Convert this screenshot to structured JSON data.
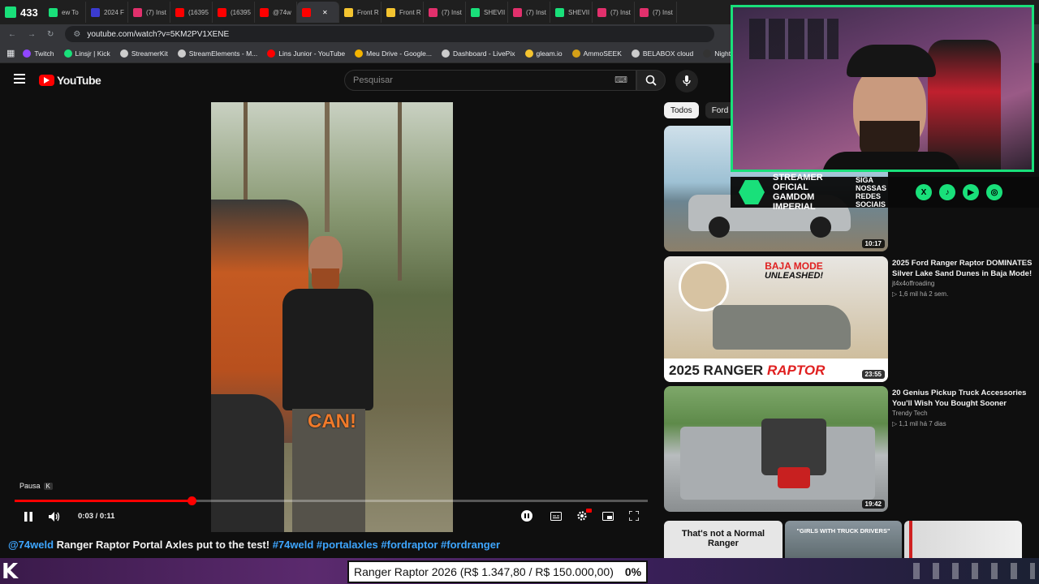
{
  "browser": {
    "counter": "433",
    "tabs": [
      {
        "label": "ew To",
        "color": "#19e07a"
      },
      {
        "label": "2024 F",
        "color": "#3b3bd1"
      },
      {
        "label": "(7) Inst",
        "color": "#e1306c"
      },
      {
        "label": "(16395",
        "color": "#ff0000"
      },
      {
        "label": "(16395",
        "color": "#ff0000"
      },
      {
        "label": "@74w",
        "color": "#ff0000"
      },
      {
        "label": "",
        "color": "#ff0000",
        "active": true
      },
      {
        "label": "Front R",
        "color": "#f4c430"
      },
      {
        "label": "Front R",
        "color": "#f4c430"
      },
      {
        "label": "(7) Inst",
        "color": "#e1306c"
      },
      {
        "label": "SHEVII",
        "color": "#19e07a"
      },
      {
        "label": "(7) Inst",
        "color": "#e1306c"
      },
      {
        "label": "SHEVII",
        "color": "#19e07a"
      },
      {
        "label": "(7) Inst",
        "color": "#e1306c"
      },
      {
        "label": "(7) Inst",
        "color": "#e1306c"
      }
    ],
    "url": "youtube.com/watch?v=5KM2PV1XENE",
    "bookmarks": [
      {
        "label": "Twitch",
        "color": "#9146ff"
      },
      {
        "label": "Linsjr | Kick",
        "color": "#19e07a"
      },
      {
        "label": "StreamerKit",
        "color": "#cccccc"
      },
      {
        "label": "StreamElements - M...",
        "color": "#cccccc"
      },
      {
        "label": "Lins Junior - YouTube",
        "color": "#ff0000"
      },
      {
        "label": "Meu Drive - Google...",
        "color": "#f4b400"
      },
      {
        "label": "Dashboard - LivePix",
        "color": "#cccccc"
      },
      {
        "label": "gleam.io",
        "color": "#f4c430"
      },
      {
        "label": "AmmoSEEK",
        "color": "#d4a017"
      },
      {
        "label": "BELABOX cloud",
        "color": "#cccccc"
      },
      {
        "label": "Nightbot - Comm",
        "color": "#333333"
      }
    ]
  },
  "youtube": {
    "logo_text": "YouTube",
    "search_placeholder": "Pesquisar",
    "keyboard_badge": "⌨",
    "player": {
      "caption": "CAN!",
      "tooltip_label": "Pausa",
      "tooltip_key": "K",
      "time": "0:03 / 0:11",
      "progress": 0.28
    },
    "video_title_prefix": "@74weld",
    "video_title_main": " Ranger Raptor Portal Axles put to the test! ",
    "video_title_tags": "#74weld #portalaxles #fordraptor #fordranger",
    "chips": [
      "Todos",
      "Ford R"
    ],
    "recommendations": [
      {
        "duration": "10:17",
        "title": "",
        "channel": "",
        "meta": ""
      },
      {
        "duration": "23:55",
        "title": "2025 Ford Ranger Raptor DOMINATES Silver Lake Sand Dunes in Baja Mode!",
        "channel": "jt4x4offroading",
        "meta": "▷ 1,6 mil  há 2 sem.",
        "thumb_text_top": "BAJA MODE",
        "thumb_text_top2": "UNLEASHED!",
        "thumb_text_bottom1": "2025 RANGER ",
        "thumb_text_bottom2": "RAPTOR"
      },
      {
        "duration": "19:42",
        "title": "20 Genius Pickup Truck Accessories You'll Wish You Bought Sooner",
        "channel": "Trendy Tech",
        "meta": "▷ 1,1 mil  há 7 dias"
      }
    ],
    "shorts": [
      {
        "text": "That's not a Normal Ranger"
      },
      {
        "text": "\"GIRLS WITH TRUCK DRIVERS\""
      },
      {
        "text": ""
      }
    ]
  },
  "overlay": {
    "banner_main": "STREAMER OFICIAL GAMDOM IMPERIAL",
    "banner_sub": "SIGA NOSSAS REDES SOCIAIS",
    "goal_text": "Ranger Raptor 2026 (R$ 1.347,80 / R$ 150.000,00)",
    "goal_percent": "0%"
  },
  "colors": {
    "accent": "#ff0000",
    "link": "#3ea6ff",
    "brand_green": "#19e07a"
  }
}
